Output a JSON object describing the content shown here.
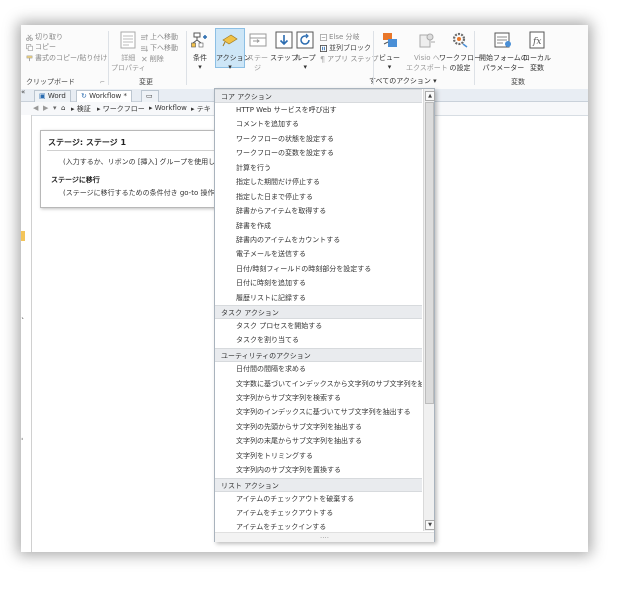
{
  "clipboard": {
    "cut": "切り取り",
    "copy": "コピー",
    "format_copy": "書式のコピー/貼り付け",
    "label": "クリップボード"
  },
  "modify": {
    "detail": "詳細",
    "properties": "プロパティ",
    "move_up": "上へ移動",
    "move_down": "下へ移動",
    "delete": "削除",
    "label": "変更"
  },
  "insert": {
    "condition": "条件",
    "action": "アクション",
    "stage": "ステー",
    "stage2": "ジ",
    "step": "ステップ",
    "loop": "ループ",
    "else_branch": "Else 分岐",
    "parallel_block": "並列ブロック",
    "app_step": "アプリ ステップ",
    "all_actions": "すべてのアクション"
  },
  "manage": {
    "view": "ビュー",
    "visio_export_1": "Visio へ",
    "visio_export_2": "エクスポート",
    "workflow_settings_1": "ワークフロー",
    "workflow_settings_2": "の設定"
  },
  "variables": {
    "init_form_1": "開始フォームの",
    "init_form_2": "パラメーター",
    "local_vars_1": "ローカル",
    "local_vars_2": "変数",
    "label": "変数"
  },
  "tabs": [
    {
      "label": "Word"
    },
    {
      "label": "Workflow *"
    }
  ],
  "breadcrumb": [
    "検証",
    "ワークフロー",
    "Workflow",
    "テキ"
  ],
  "stage": {
    "title": "ステージ: ステージ 1",
    "hint": "(入力するか、リボンの [挿入] グループを使用して",
    "transition_label": "ステージに移行",
    "transition_hint": "(ステージに移行するための条件付き go-to 操作"
  },
  "dropdown": {
    "core_label": "コア アクション",
    "core_items": [
      "HTTP Web サービスを呼び出す",
      "コメントを追加する",
      "ワークフローの状態を設定する",
      "ワークフローの変数を設定する",
      "計算を行う",
      "指定した期間だけ停止する",
      "指定した日まで停止する",
      "辞書からアイテムを取得する",
      "辞書を作成",
      "辞書内のアイテムをカウントする",
      "電子メールを送信する",
      "日付/時刻フィールドの時刻部分を設定する",
      "日付に時刻を追加する",
      "履歴リストに記録する"
    ],
    "task_label": "タスク アクション",
    "task_items": [
      "タスク プロセスを開始する",
      "タスクを割り当てる"
    ],
    "utility_label": "ユーティリティのアクション",
    "utility_items": [
      "日付間の間隔を求める",
      "文字数に基づいてインデックスから文字列のサブ文字列を抽出する",
      "文字列からサブ文字列を検索する",
      "文字列のインデックスに基づいてサブ文字列を抽出する",
      "文字列の先頭からサブ文字列を抽出する",
      "文字列の末尾からサブ文字列を抽出する",
      "文字列をトリミングする",
      "文字列内のサブ文字列を置換する"
    ],
    "list_label": "リスト アクション",
    "list_items": [
      "アイテムのチェックアウトを破棄する",
      "アイテムをチェックアウトする",
      "アイテムをチェックインする"
    ],
    "footer": "...."
  },
  "colors": {
    "accent_blue": "#2b6cb0",
    "ribbon_bg": "#fbfbfb",
    "action_highlight": "#cde6f7",
    "category_bg": "#e9ebee"
  }
}
